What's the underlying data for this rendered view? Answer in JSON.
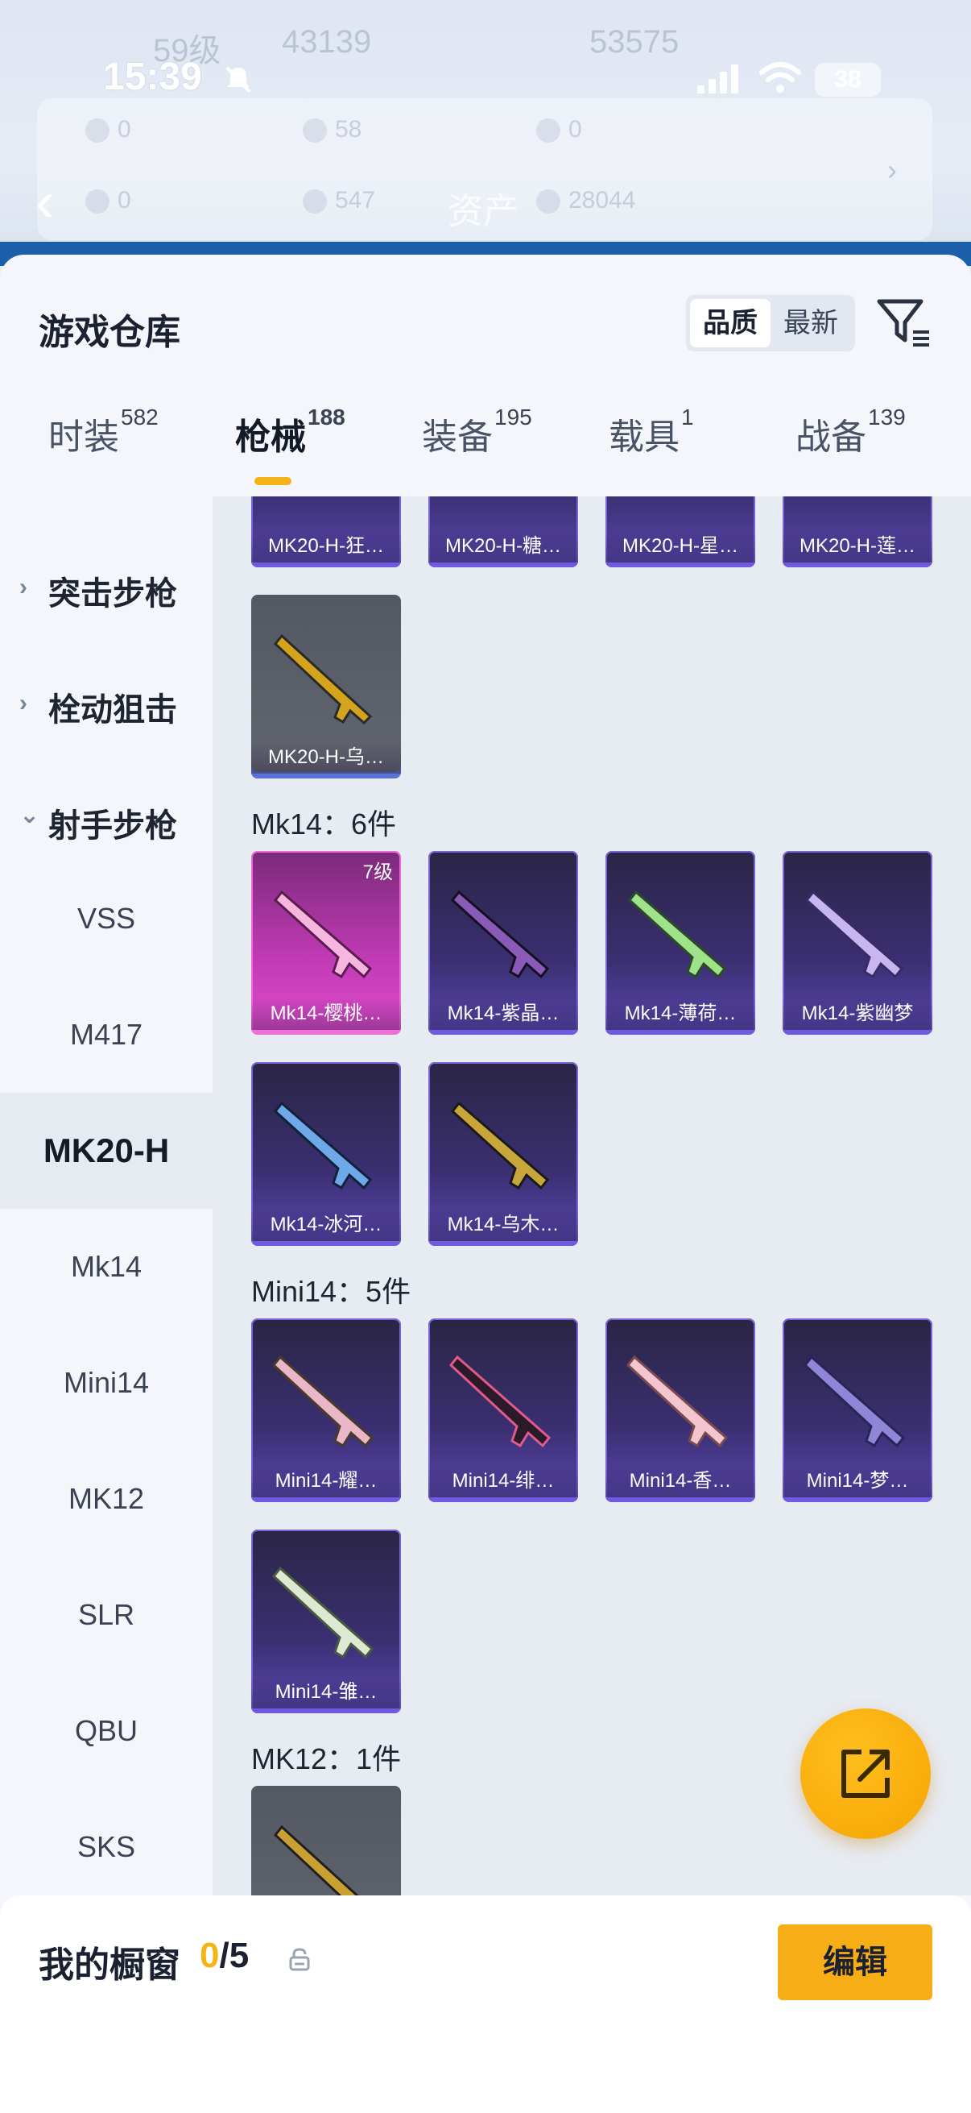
{
  "status_bar": {
    "time": "15:39",
    "battery": "38"
  },
  "background_app": {
    "level": "59级",
    "coins_a": "43139",
    "coins_b": "53575",
    "asset_row1": [
      "0",
      "58",
      "0"
    ],
    "asset_row2": [
      "0",
      "547",
      "28044"
    ],
    "title": "资产"
  },
  "sheet": {
    "title": "游戏仓库",
    "sort": {
      "quality": "品质",
      "latest": "最新"
    },
    "tabs": [
      {
        "label": "时装",
        "count": "582"
      },
      {
        "label": "枪械",
        "count": "188"
      },
      {
        "label": "装备",
        "count": "195"
      },
      {
        "label": "载具",
        "count": "1"
      },
      {
        "label": "战备",
        "count": "139"
      }
    ],
    "categories": {
      "groups": [
        "突击步枪",
        "栓动狙击",
        "射手步枪"
      ],
      "items": [
        "VSS",
        "M417",
        "MK20-H",
        "Mk14",
        "Mini14",
        "MK12",
        "SLR",
        "QBU",
        "SKS"
      ]
    },
    "sections": {
      "mk20h_partial": [
        "MK20-H-狂…",
        "MK20-H-糖…",
        "MK20-H-星…",
        "MK20-H-莲…"
      ],
      "mk20h_last": "MK20-H-乌…",
      "mk14_label": "Mk14：6件",
      "mk14": [
        "Mk14-樱桃…",
        "Mk14-紫晶…",
        "Mk14-薄荷…",
        "Mk14-紫幽梦",
        "Mk14-冰河…",
        "Mk14-乌木…"
      ],
      "mk14_level": "7级",
      "mini14_label": "Mini14：5件",
      "mini14": [
        "Mini14-耀…",
        "Mini14-绯…",
        "Mini14-香…",
        "Mini14-梦…",
        "Mini14-雏…"
      ],
      "mk12_label": "MK12：1件"
    }
  },
  "bottom_bar": {
    "label": "我的橱窗",
    "count_current": "0",
    "count_total": "/5",
    "edit": "编辑"
  },
  "colors": {
    "accent": "#f5b416",
    "purple_card": "#3b2f72",
    "pink_card": "#c23bb6"
  }
}
